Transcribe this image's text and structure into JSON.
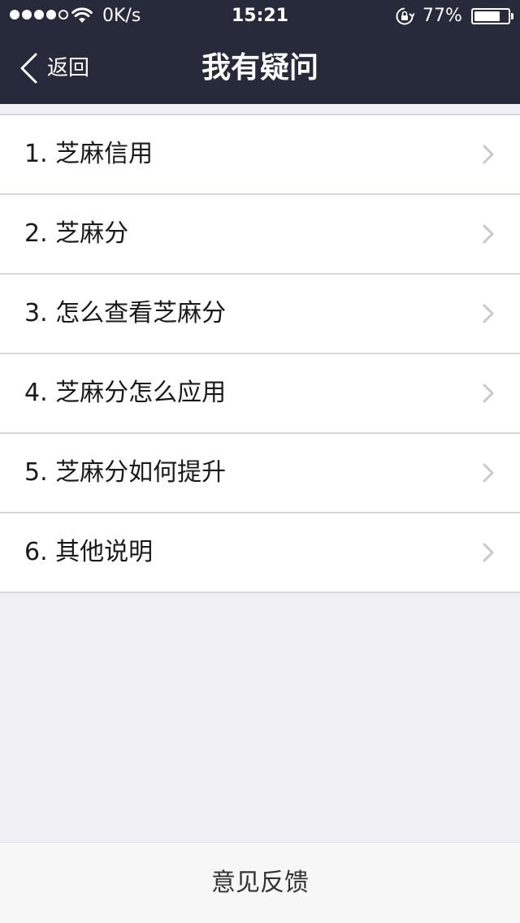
{
  "status_bar": {
    "network_speed": "0K/s",
    "time": "15:21",
    "battery_percent": "77%",
    "battery_level": 0.77,
    "icons": [
      "signal-dots",
      "wifi-icon",
      "rotation-lock-icon",
      "battery-icon"
    ]
  },
  "nav": {
    "back_label": "返回",
    "title": "我有疑问",
    "back_icon": "chevron-left-icon"
  },
  "list": {
    "items": [
      {
        "label": "1. 芝麻信用"
      },
      {
        "label": "2. 芝麻分"
      },
      {
        "label": "3. 怎么查看芝麻分"
      },
      {
        "label": "4. 芝麻分怎么应用"
      },
      {
        "label": "5. 芝麻分如何提升"
      },
      {
        "label": "6. 其他说明"
      }
    ],
    "row_icon": "chevron-right-icon"
  },
  "footer": {
    "feedback_label": "意见反馈"
  },
  "colors": {
    "header_bg": "#262a3a",
    "page_bg": "#efeff4",
    "chevron": "#c7c7cc"
  }
}
